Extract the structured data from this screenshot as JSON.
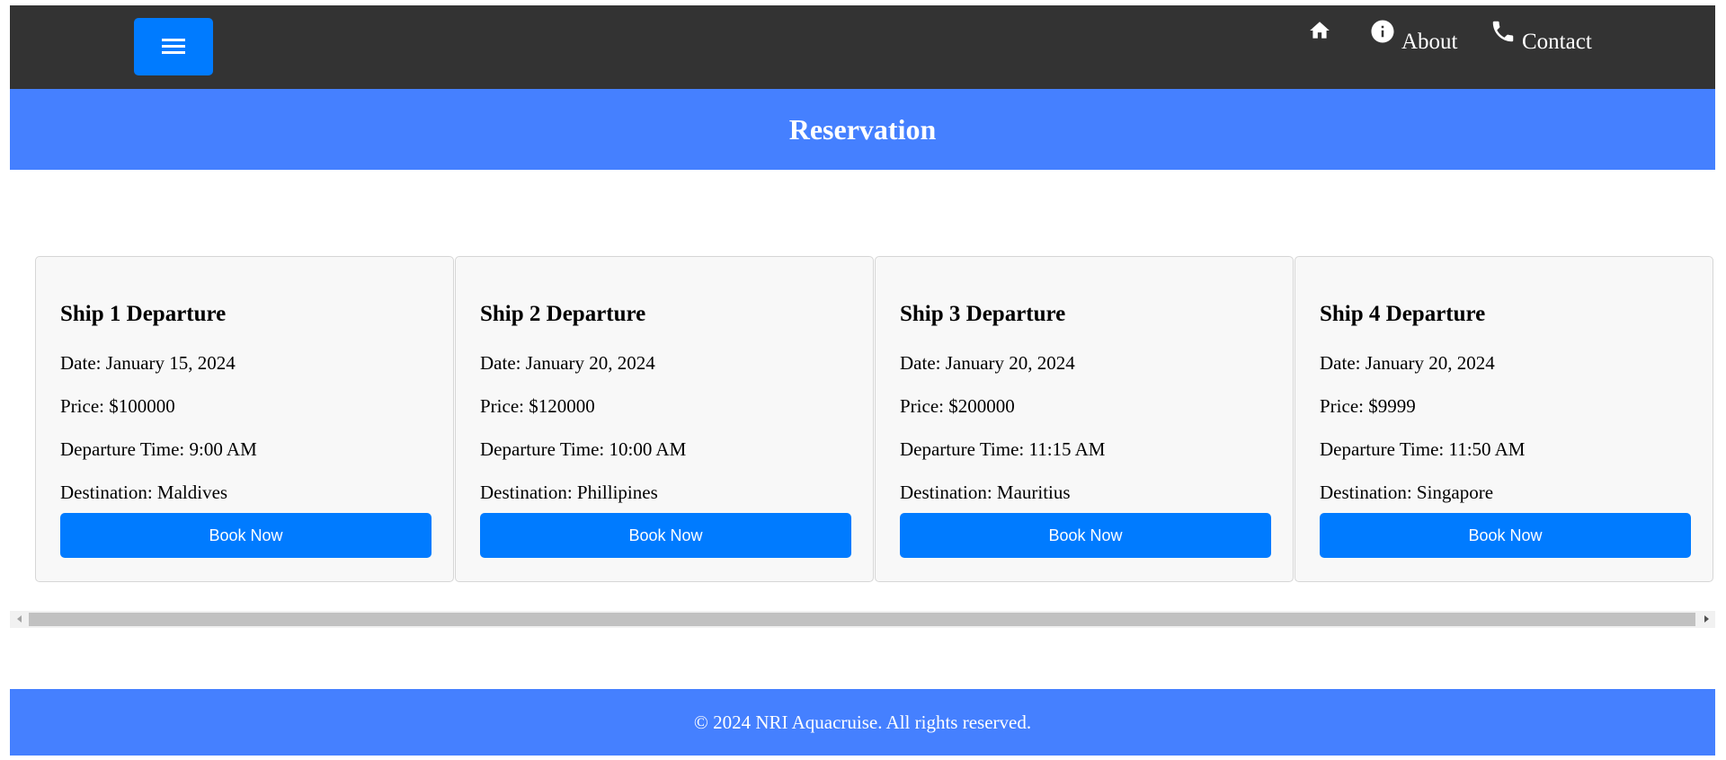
{
  "navbar": {
    "menu_icon": "hamburger-menu-icon",
    "links": [
      {
        "icon": "home-icon",
        "label": ""
      },
      {
        "icon": "info-icon",
        "label": "About"
      },
      {
        "icon": "phone-icon",
        "label": "Contact"
      }
    ]
  },
  "banner": {
    "title": "Reservation"
  },
  "cards": [
    {
      "title": "Ship 1 Departure",
      "date": "Date: January 15, 2024",
      "price": "Price: $100000",
      "time": "Departure Time: 9:00 AM",
      "destination": "Destination: Maldives",
      "button": "Book Now"
    },
    {
      "title": "Ship 2 Departure",
      "date": "Date: January 20, 2024",
      "price": "Price: $120000",
      "time": "Departure Time: 10:00 AM",
      "destination": "Destination: Phillipines",
      "button": "Book Now"
    },
    {
      "title": "Ship 3 Departure",
      "date": "Date: January 20, 2024",
      "price": "Price: $200000",
      "time": "Departure Time: 11:15 AM",
      "destination": "Destination: Mauritius",
      "button": "Book Now"
    },
    {
      "title": "Ship 4 Departure",
      "date": "Date: January 20, 2024",
      "price": "Price: $9999",
      "time": "Departure Time: 11:50 AM",
      "destination": "Destination: Singapore",
      "button": "Book Now"
    }
  ],
  "footer": {
    "text": "© 2024 NRI Aquacruise. All rights reserved."
  },
  "colors": {
    "navbar": "#333333",
    "accent": "#4580ff",
    "button": "#007bff",
    "card_bg": "#f8f8f8"
  }
}
